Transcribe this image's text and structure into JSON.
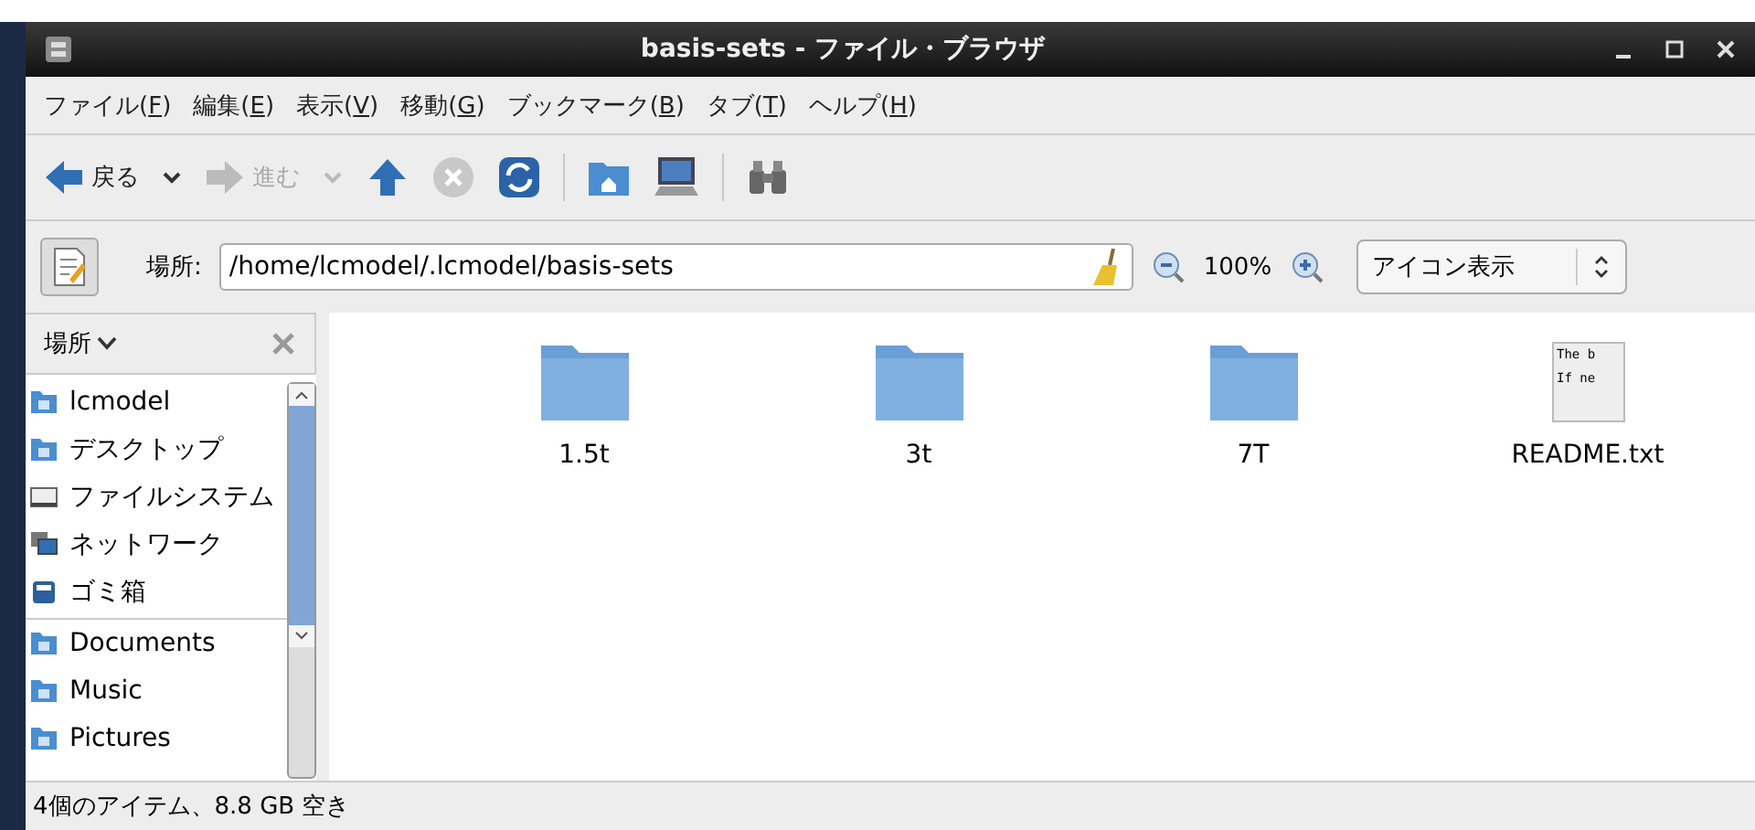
{
  "window": {
    "title": "basis-sets - ファイル・ブラウザ"
  },
  "menu": [
    "ファイル(F)",
    "編集(E)",
    "表示(V)",
    "移動(G)",
    "ブックマーク(B)",
    "タブ(T)",
    "ヘルプ(H)"
  ],
  "toolbar": {
    "back": "戻る",
    "forward": "進む",
    "forward_disabled": true
  },
  "location": {
    "label": "場所:",
    "value": "/home/lcmodel/.lcmodel/basis-sets",
    "zoom": "100%",
    "view": "アイコン表示"
  },
  "sidebar": {
    "title": "場所",
    "items": [
      {
        "label": "lcmodel",
        "kind": "home",
        "separator_before": false
      },
      {
        "label": "デスクトップ",
        "kind": "desktop",
        "separator_before": false
      },
      {
        "label": "ファイルシステム",
        "kind": "drive",
        "separator_before": false
      },
      {
        "label": "ネットワーク",
        "kind": "network",
        "separator_before": false
      },
      {
        "label": "ゴミ箱",
        "kind": "trash",
        "separator_before": false
      },
      {
        "label": "Documents",
        "kind": "documents",
        "separator_before": true
      },
      {
        "label": "Music",
        "kind": "music",
        "separator_before": false
      },
      {
        "label": "Pictures",
        "kind": "pictures",
        "separator_before": false
      }
    ]
  },
  "files": [
    {
      "name": "1.5t",
      "kind": "folder"
    },
    {
      "name": "3t",
      "kind": "folder"
    },
    {
      "name": "7T",
      "kind": "folder"
    },
    {
      "name": "README.txt",
      "kind": "text",
      "preview": [
        "The b",
        "If ne"
      ]
    }
  ],
  "status_bar": "4個のアイテム、8.8 GB 空き"
}
